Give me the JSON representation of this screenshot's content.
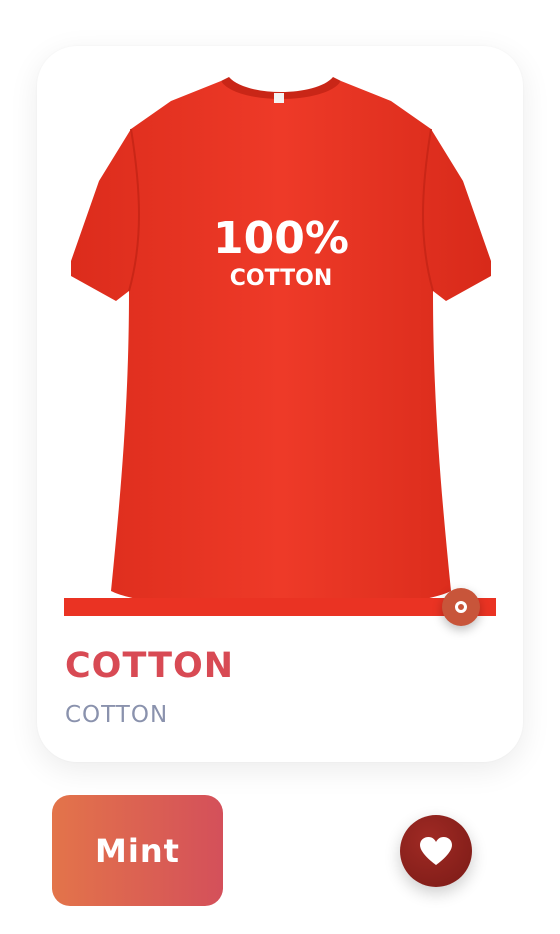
{
  "product": {
    "title": "COTTON",
    "subtitle": "COTTON",
    "shirt_print_line1": "100%",
    "shirt_print_line2": "COTTON",
    "shirt_color": "#ea3323"
  },
  "slider": {
    "value_fraction": 0.92,
    "fill_color": "#ea3323",
    "thumb_color": "#c8553a"
  },
  "actions": {
    "mint_label": "Mint",
    "favorite_icon": "heart-icon"
  },
  "colors": {
    "title": "#d84a54",
    "subtitle": "#8a92ad",
    "mint_gradient_start": "#e3744a",
    "mint_gradient_end": "#d4505a",
    "favorite_bg": "#7a1a16"
  }
}
